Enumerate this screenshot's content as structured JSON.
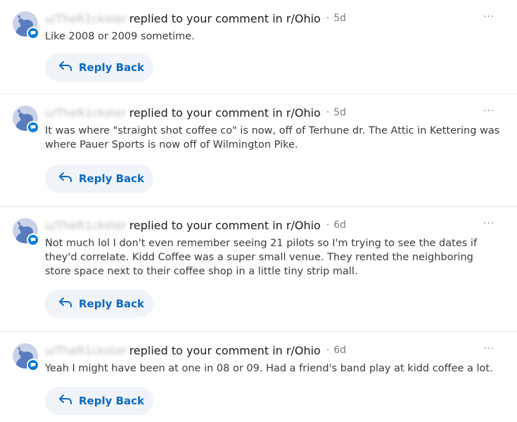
{
  "notifications": [
    {
      "username": "u/TheR1ckster",
      "action": "replied to your comment in r/Ohio",
      "separator": "·",
      "age": "5d",
      "body": "Like 2008 or 2009 sometime.",
      "reply_label": "Reply Back",
      "more_label": "···"
    },
    {
      "username": "u/TheR1ckster",
      "action": "replied to your comment in r/Ohio",
      "separator": "·",
      "age": "5d",
      "body": "It was where \"straight shot coffee co\" is now, off of Terhune dr. The Attic in Kettering was where Pauer Sports is now off of Wilmington Pike.",
      "reply_label": "Reply Back",
      "more_label": "···"
    },
    {
      "username": "u/TheR1ckster",
      "action": "replied to your comment in r/Ohio",
      "separator": "·",
      "age": "6d",
      "body": "Not much lol I don't even remember seeing 21 pilots so I'm trying to see the dates if they'd correlate. Kidd Coffee was a super small venue. They rented the neighboring store space next to their coffee shop in a little tiny strip mall.",
      "reply_label": "Reply Back",
      "more_label": "···"
    },
    {
      "username": "u/TheR1ckster",
      "action": "replied to your comment in r/Ohio",
      "separator": "·",
      "age": "6d",
      "body": "Yeah I might have been at one in 08 or 09. Had a friend's band play at kidd coffee a lot.",
      "reply_label": "Reply Back",
      "more_label": "···"
    }
  ],
  "colors": {
    "accent": "#0079d3",
    "reply_text": "#0b6bc4",
    "reply_bg": "#f0f3f7",
    "avatar_bg": "#c9d3e8",
    "divider": "#e4e6e8"
  },
  "icons": {
    "avatar": "snoo-avatar-icon",
    "badge": "comment-badge-icon",
    "reply": "reply-arrow-icon",
    "more": "more-options-icon"
  }
}
